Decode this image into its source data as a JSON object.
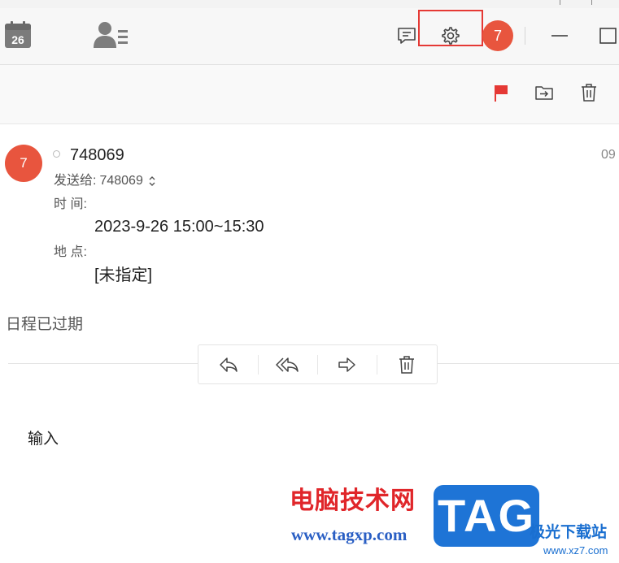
{
  "titlebar": {
    "calendar_day": "26",
    "unread_count": "7"
  },
  "message": {
    "avatar_initial": "7",
    "sender": "748069",
    "date_partial": "09",
    "recipients_label": "发送给:",
    "recipients_value": "748069",
    "time_label": "时 间:",
    "time_value": "2023-9-26 15:00~15:30",
    "location_label": "地 点:",
    "location_value": "[未指定]",
    "expired_notice": "日程已过期",
    "body": "输入"
  },
  "watermark": {
    "title": "电脑技术网",
    "url": "www.tagxp.com",
    "logo": "TAG",
    "site": "极光下载站",
    "site_url": "www.xz7.com"
  },
  "icons": {
    "calendar": "calendar-icon",
    "contacts": "contacts-icon",
    "chat": "chat-icon",
    "settings": "gear-icon",
    "minimize": "minimize-icon",
    "maximize": "maximize-icon",
    "flag": "flag-icon",
    "move": "move-to-folder-icon",
    "delete": "trash-icon",
    "reply": "reply-icon",
    "reply_all": "reply-all-icon",
    "forward": "forward-icon"
  },
  "colors": {
    "accent_red": "#e8553e",
    "flag_red": "#e53935",
    "highlight_box": "#e53935"
  }
}
